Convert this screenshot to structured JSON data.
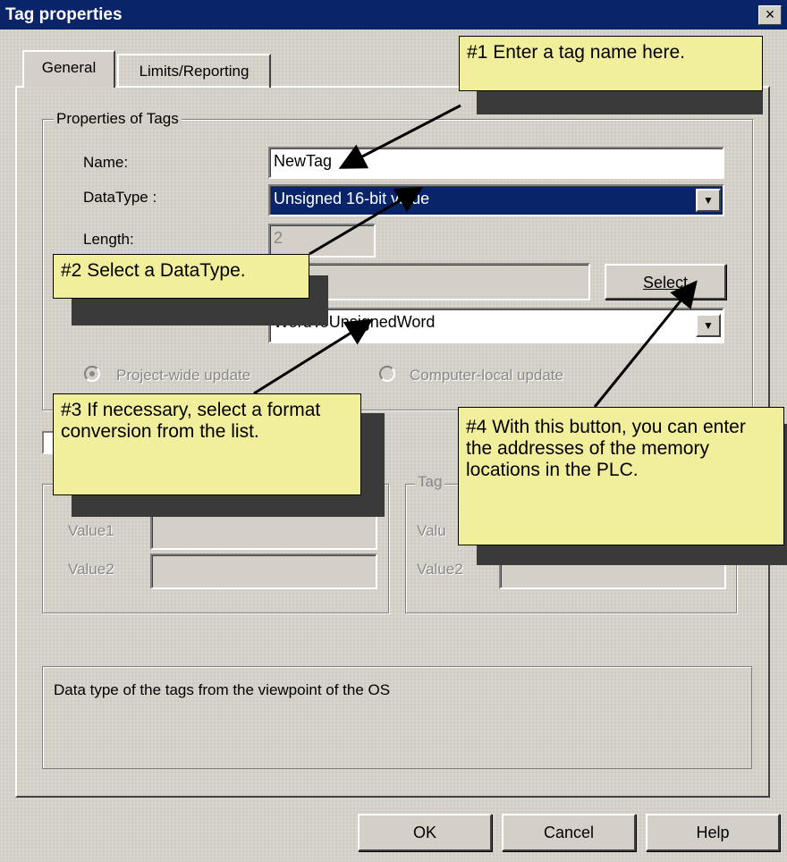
{
  "window": {
    "title": "Tag properties",
    "close_symbol": "×"
  },
  "tabs": [
    {
      "label": "General"
    },
    {
      "label": "Limits/Reporting"
    }
  ],
  "properties": {
    "legend": "Properties of Tags",
    "name_label": "Name:",
    "name_value": "NewTag",
    "datatype_label": "DataType :",
    "datatype_value": "Unsigned 16-bit value",
    "length_label": "Length:",
    "length_value": "2",
    "address_value": "",
    "select_button": "Select",
    "conversion_value": "WordToUnsignedWord",
    "update_project_wide": "Project-wide update",
    "update_computer_local": "Computer-local update"
  },
  "limits": {
    "left": {
      "value1_label": "Value1",
      "value2_label": "Value2"
    },
    "right": {
      "legend_partial": "Tag",
      "value1_label": "Valu",
      "value2_label": "Value2"
    }
  },
  "description": "Data type of the tags from the viewpoint of the OS",
  "buttons": {
    "ok": "OK",
    "cancel": "Cancel",
    "help": "Help"
  },
  "callouts": [
    {
      "text": "#1 Enter a tag name here."
    },
    {
      "text": "#2 Select a DataType."
    },
    {
      "text": "#3 If necessary, select a format conversion from the list."
    },
    {
      "text": "#4 With this button, you can enter the addresses of the memory locations in the PLC."
    }
  ],
  "colors": {
    "titlebar": "#0a246a",
    "dialog": "#d4d0c8",
    "callout": "#f1ee9c"
  }
}
